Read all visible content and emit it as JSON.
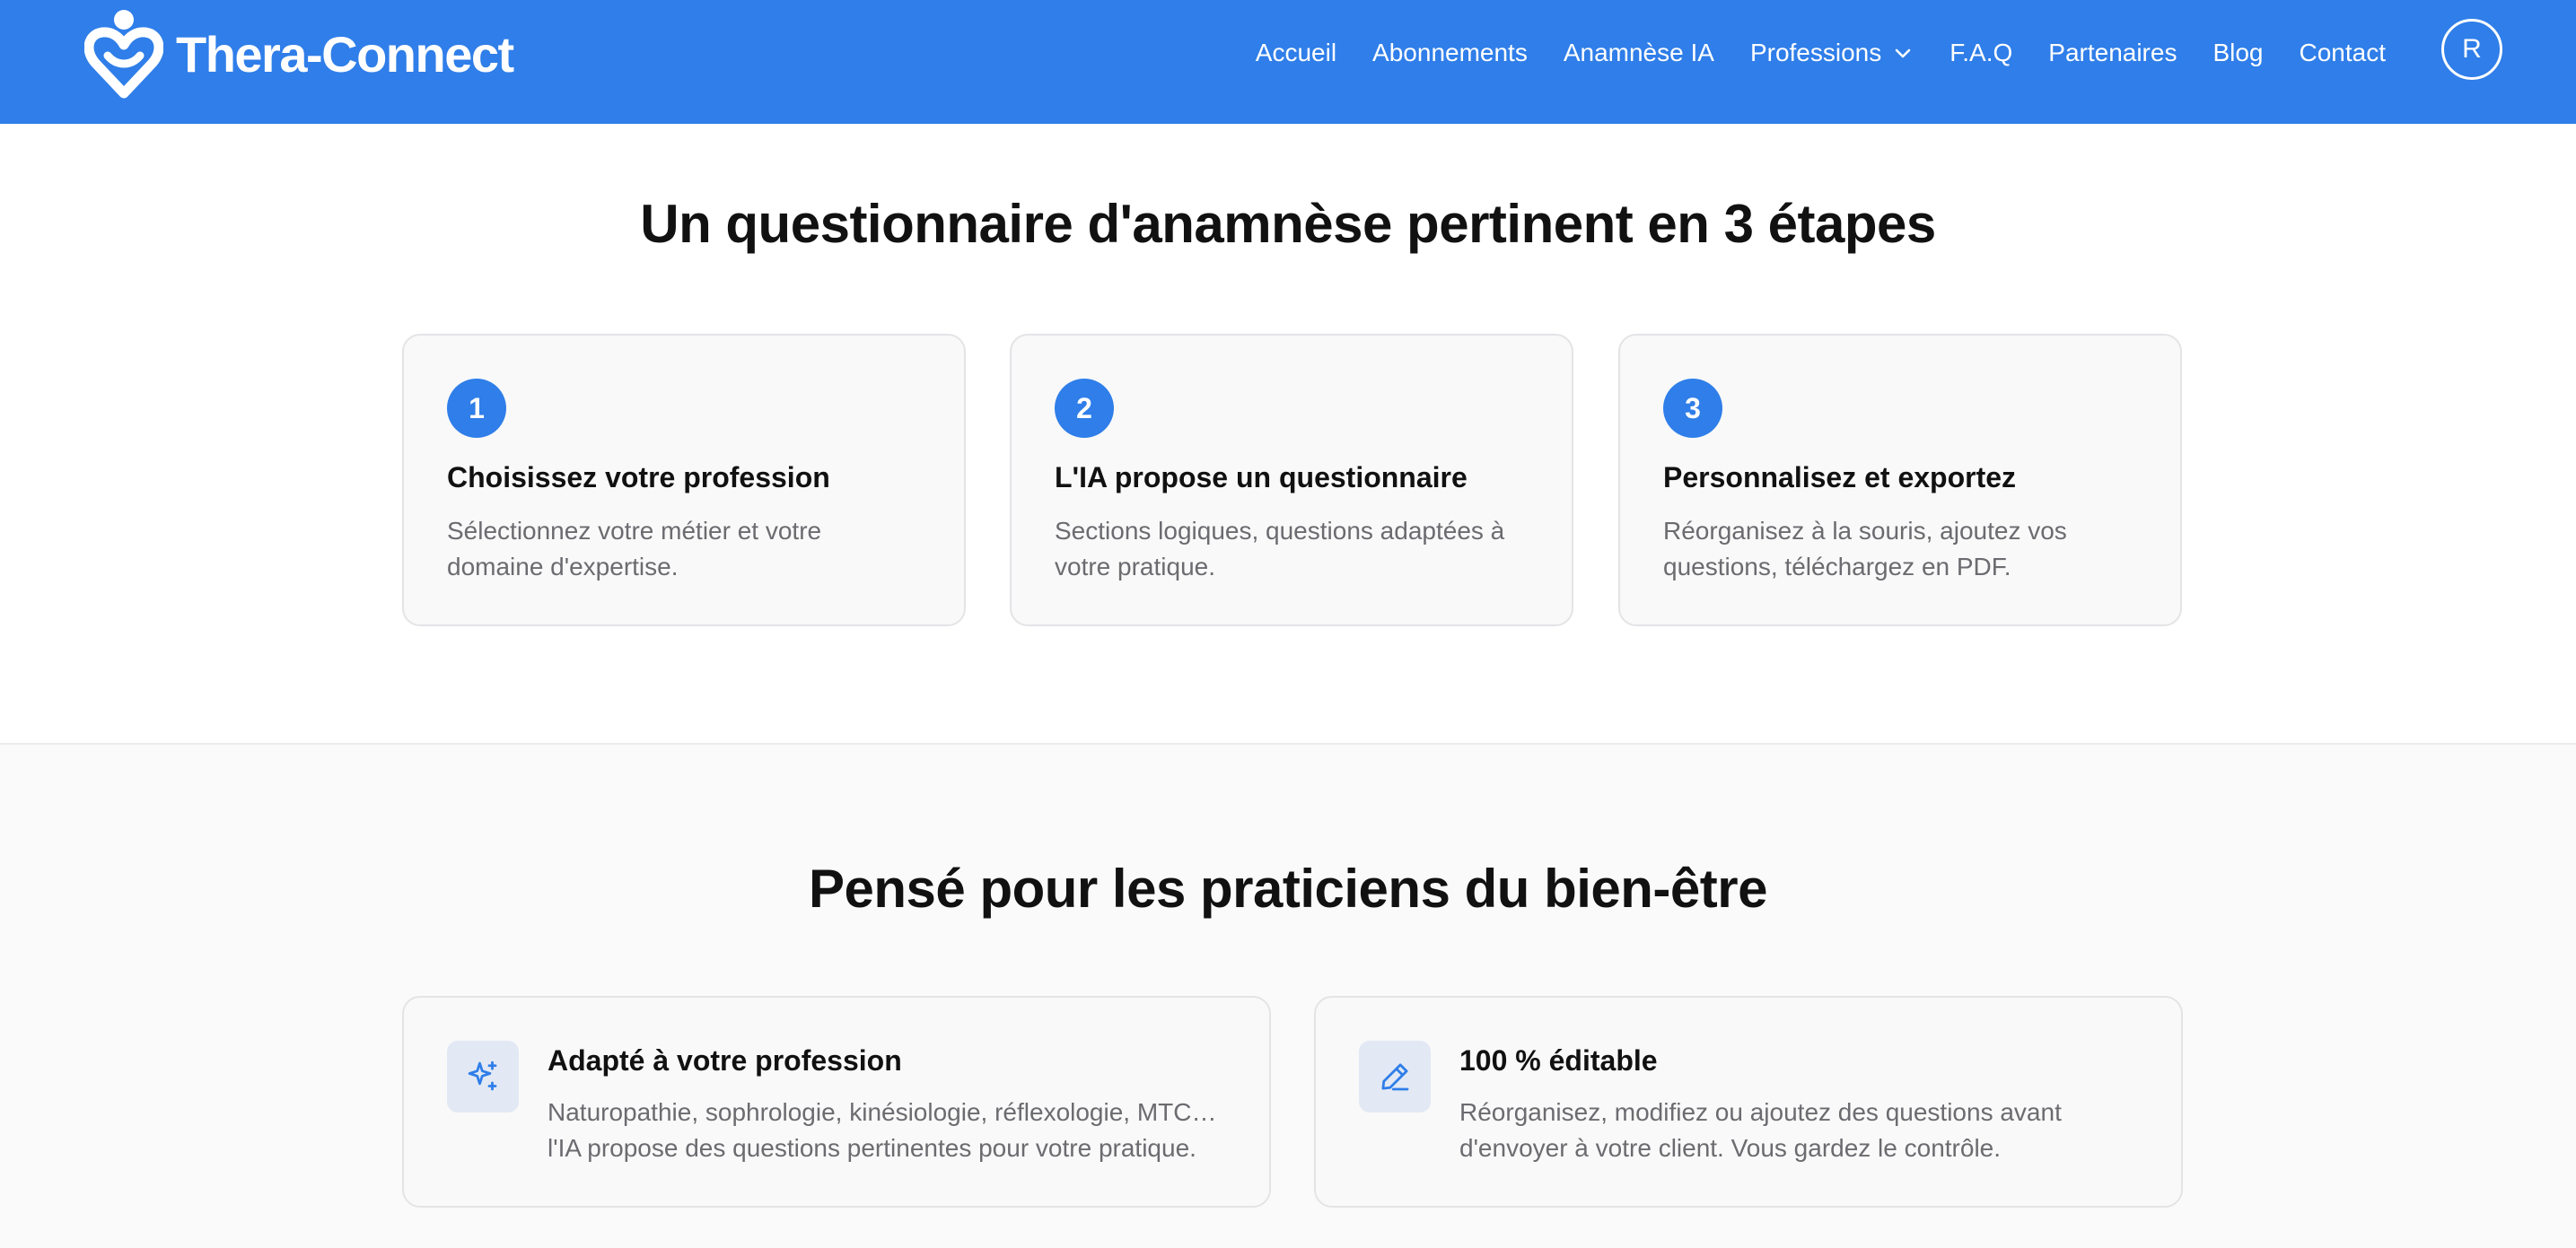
{
  "brand": {
    "name": "Thera-Connect",
    "color": "#2f7ee9"
  },
  "nav": {
    "items": [
      "Accueil",
      "Abonnements",
      "Anamnèse IA"
    ],
    "professions": "Professions",
    "items_after": [
      "F.A.Q",
      "Partenaires",
      "Blog",
      "Contact"
    ],
    "avatar_initial": "R"
  },
  "steps_section": {
    "title": "Un questionnaire d'anamnèse pertinent en 3 étapes",
    "steps": [
      {
        "number": "1",
        "title": "Choisissez votre profession",
        "desc_lines": [
          "Sélectionnez votre métier et votre",
          "domaine d'expertise."
        ]
      },
      {
        "number": "2",
        "title": "L'IA propose un questionnaire",
        "desc_lines": [
          "Sections logiques, questions adaptées à",
          "votre pratique."
        ]
      },
      {
        "number": "3",
        "title": "Personnalisez et exportez",
        "desc_lines": [
          "Réorganisez à la souris, ajoutez vos",
          "questions, téléchargez en PDF."
        ]
      }
    ]
  },
  "features_section": {
    "title": "Pensé pour les praticiens du bien-être",
    "features": [
      {
        "icon": "sparkles-icon",
        "title": "Adapté à votre profession",
        "desc_lines": [
          "Naturopathie, sophrologie, kinésiologie, réflexologie, MTC…",
          "l'IA propose des questions pertinentes pour votre pratique."
        ]
      },
      {
        "icon": "pencil-icon",
        "title": "100 % éditable",
        "desc_lines": [
          "Réorganisez, modifiez ou ajoutez des questions avant",
          "d'envoyer à votre client. Vous gardez le contrôle."
        ]
      }
    ]
  }
}
